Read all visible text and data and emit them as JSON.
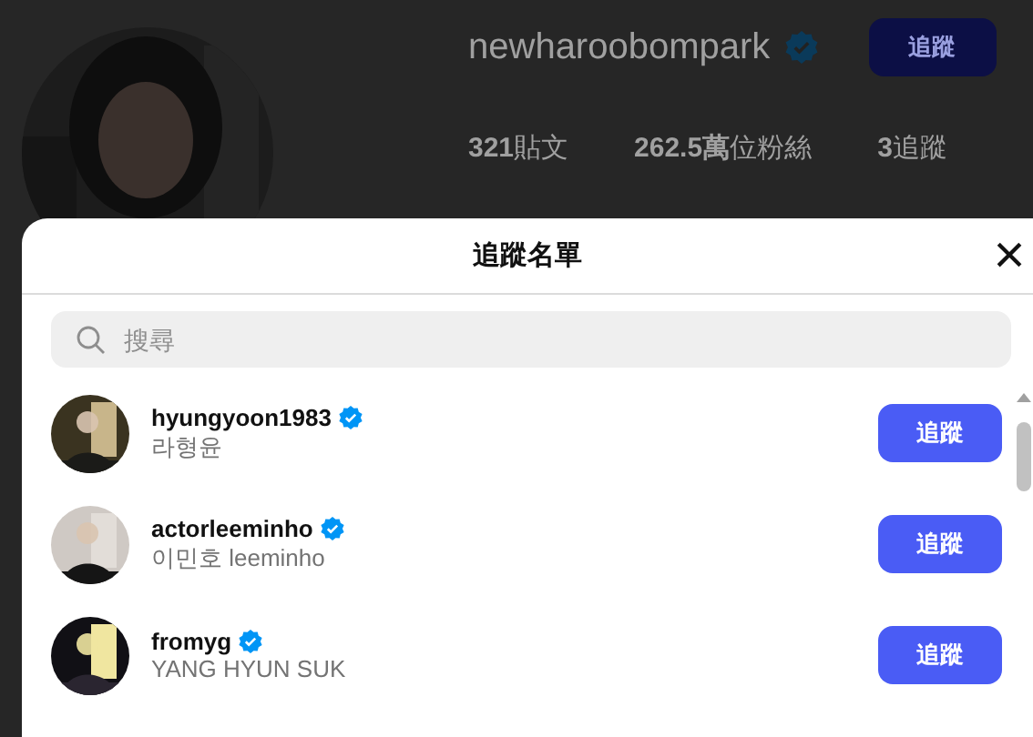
{
  "profile": {
    "username": "newharoobompark",
    "verified": true,
    "follow_button": "追蹤",
    "stats": [
      {
        "value": "321",
        "label": "貼文"
      },
      {
        "value": "262.5萬",
        "label": "位粉絲"
      },
      {
        "value": "3",
        "label": "追蹤"
      }
    ]
  },
  "dialog": {
    "title": "追蹤名單",
    "close": "×",
    "search": {
      "placeholder": "搜尋"
    },
    "users": [
      {
        "username": "hyungyoon1983",
        "verified": true,
        "name": "라형윤",
        "button": "追蹤"
      },
      {
        "username": "actorleeminho",
        "verified": true,
        "name": "이민호 leeminho",
        "button": "追蹤"
      },
      {
        "username": "fromyg",
        "verified": true,
        "name": "YANG HYUN SUK",
        "button": "追蹤"
      }
    ]
  }
}
